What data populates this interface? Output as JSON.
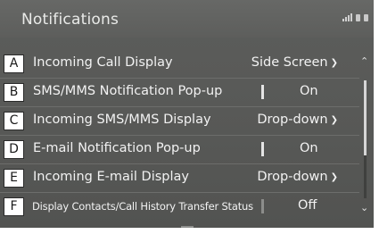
{
  "header": {
    "title": "Notifications"
  },
  "rows": [
    {
      "letter": "A",
      "label": "Incoming Call Display",
      "value": "Side Screen",
      "has_dropdown": true,
      "toggle": false
    },
    {
      "letter": "B",
      "label": "SMS/MMS Notification Pop-up",
      "value": "On",
      "has_dropdown": false,
      "toggle": true,
      "toggle_state": "on"
    },
    {
      "letter": "C",
      "label": "Incoming SMS/MMS Display",
      "value": "Drop-down",
      "has_dropdown": true,
      "toggle": false
    },
    {
      "letter": "D",
      "label": "E-mail Notification Pop-up",
      "value": "On",
      "has_dropdown": false,
      "toggle": true,
      "toggle_state": "on"
    },
    {
      "letter": "E",
      "label": "Incoming E-mail Display",
      "value": "Drop-down",
      "has_dropdown": true,
      "toggle": false
    },
    {
      "letter": "F",
      "label": "Display Contacts/Call History Transfer Status",
      "value": "Off",
      "has_dropdown": false,
      "toggle": true,
      "toggle_state": "off"
    }
  ],
  "scrollbar": {
    "up": "⌃",
    "down": "⌄"
  }
}
